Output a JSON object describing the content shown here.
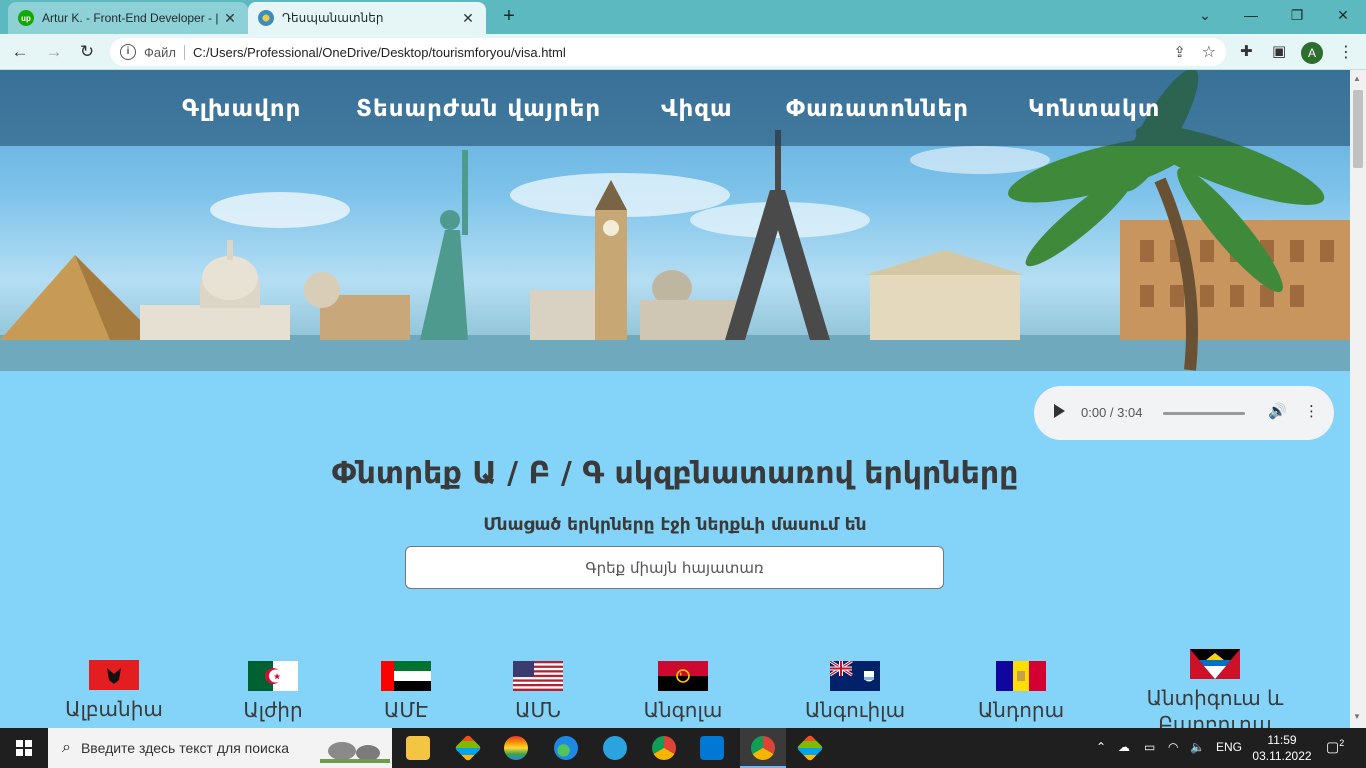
{
  "browser": {
    "tabs": [
      {
        "title": "Artur K. - Front-End Developer - |",
        "icon": "upwork-icon",
        "active": false
      },
      {
        "title": "Դեսպանատներ",
        "icon": "site-globe-icon",
        "active": true
      }
    ],
    "new_tab": "+",
    "address_label": "Файл",
    "url": "C:/Users/Professional/OneDrive/Desktop/tourismforyou/visa.html",
    "profile_initial": "A"
  },
  "nav": {
    "items": [
      "Գլխավոր",
      "Տեսարժան վայրեր",
      "Վիզա",
      "Փառատոններ",
      "Կոնտակտ"
    ]
  },
  "audio": {
    "time": "0:00 / 3:04"
  },
  "page": {
    "heading": "Փնտրեք Ա / Բ / Գ սկզբնատառով երկրները",
    "subheading": "Մնացած երկրները էջի ներքևի մասում են",
    "search_placeholder": "Գրեք միայն հայատառ"
  },
  "countries": [
    {
      "name": "Ալբանիա",
      "flag": "albania"
    },
    {
      "name": "Ալժիր",
      "flag": "algeria"
    },
    {
      "name": "ԱՄԷ",
      "flag": "uae"
    },
    {
      "name": "ԱՄՆ",
      "flag": "usa"
    },
    {
      "name": "Անգոլա",
      "flag": "angola"
    },
    {
      "name": "Անգուիլա",
      "flag": "anguilla"
    },
    {
      "name": "Անդորա",
      "flag": "andorra"
    },
    {
      "name": "Անտիգուա և Բարբուդա",
      "flag": "antigua-barbuda"
    }
  ],
  "taskbar": {
    "search_placeholder": "Введите здесь текст для поиска",
    "language": "ENG",
    "time": "11:59",
    "date": "03.11.2022",
    "notifications": "2"
  },
  "colors": {
    "page_bg": "#84d3f8",
    "tabbar": "#5cb9c0",
    "toolbar": "#e6f6f7",
    "nav_overlay": "#1e4664"
  }
}
